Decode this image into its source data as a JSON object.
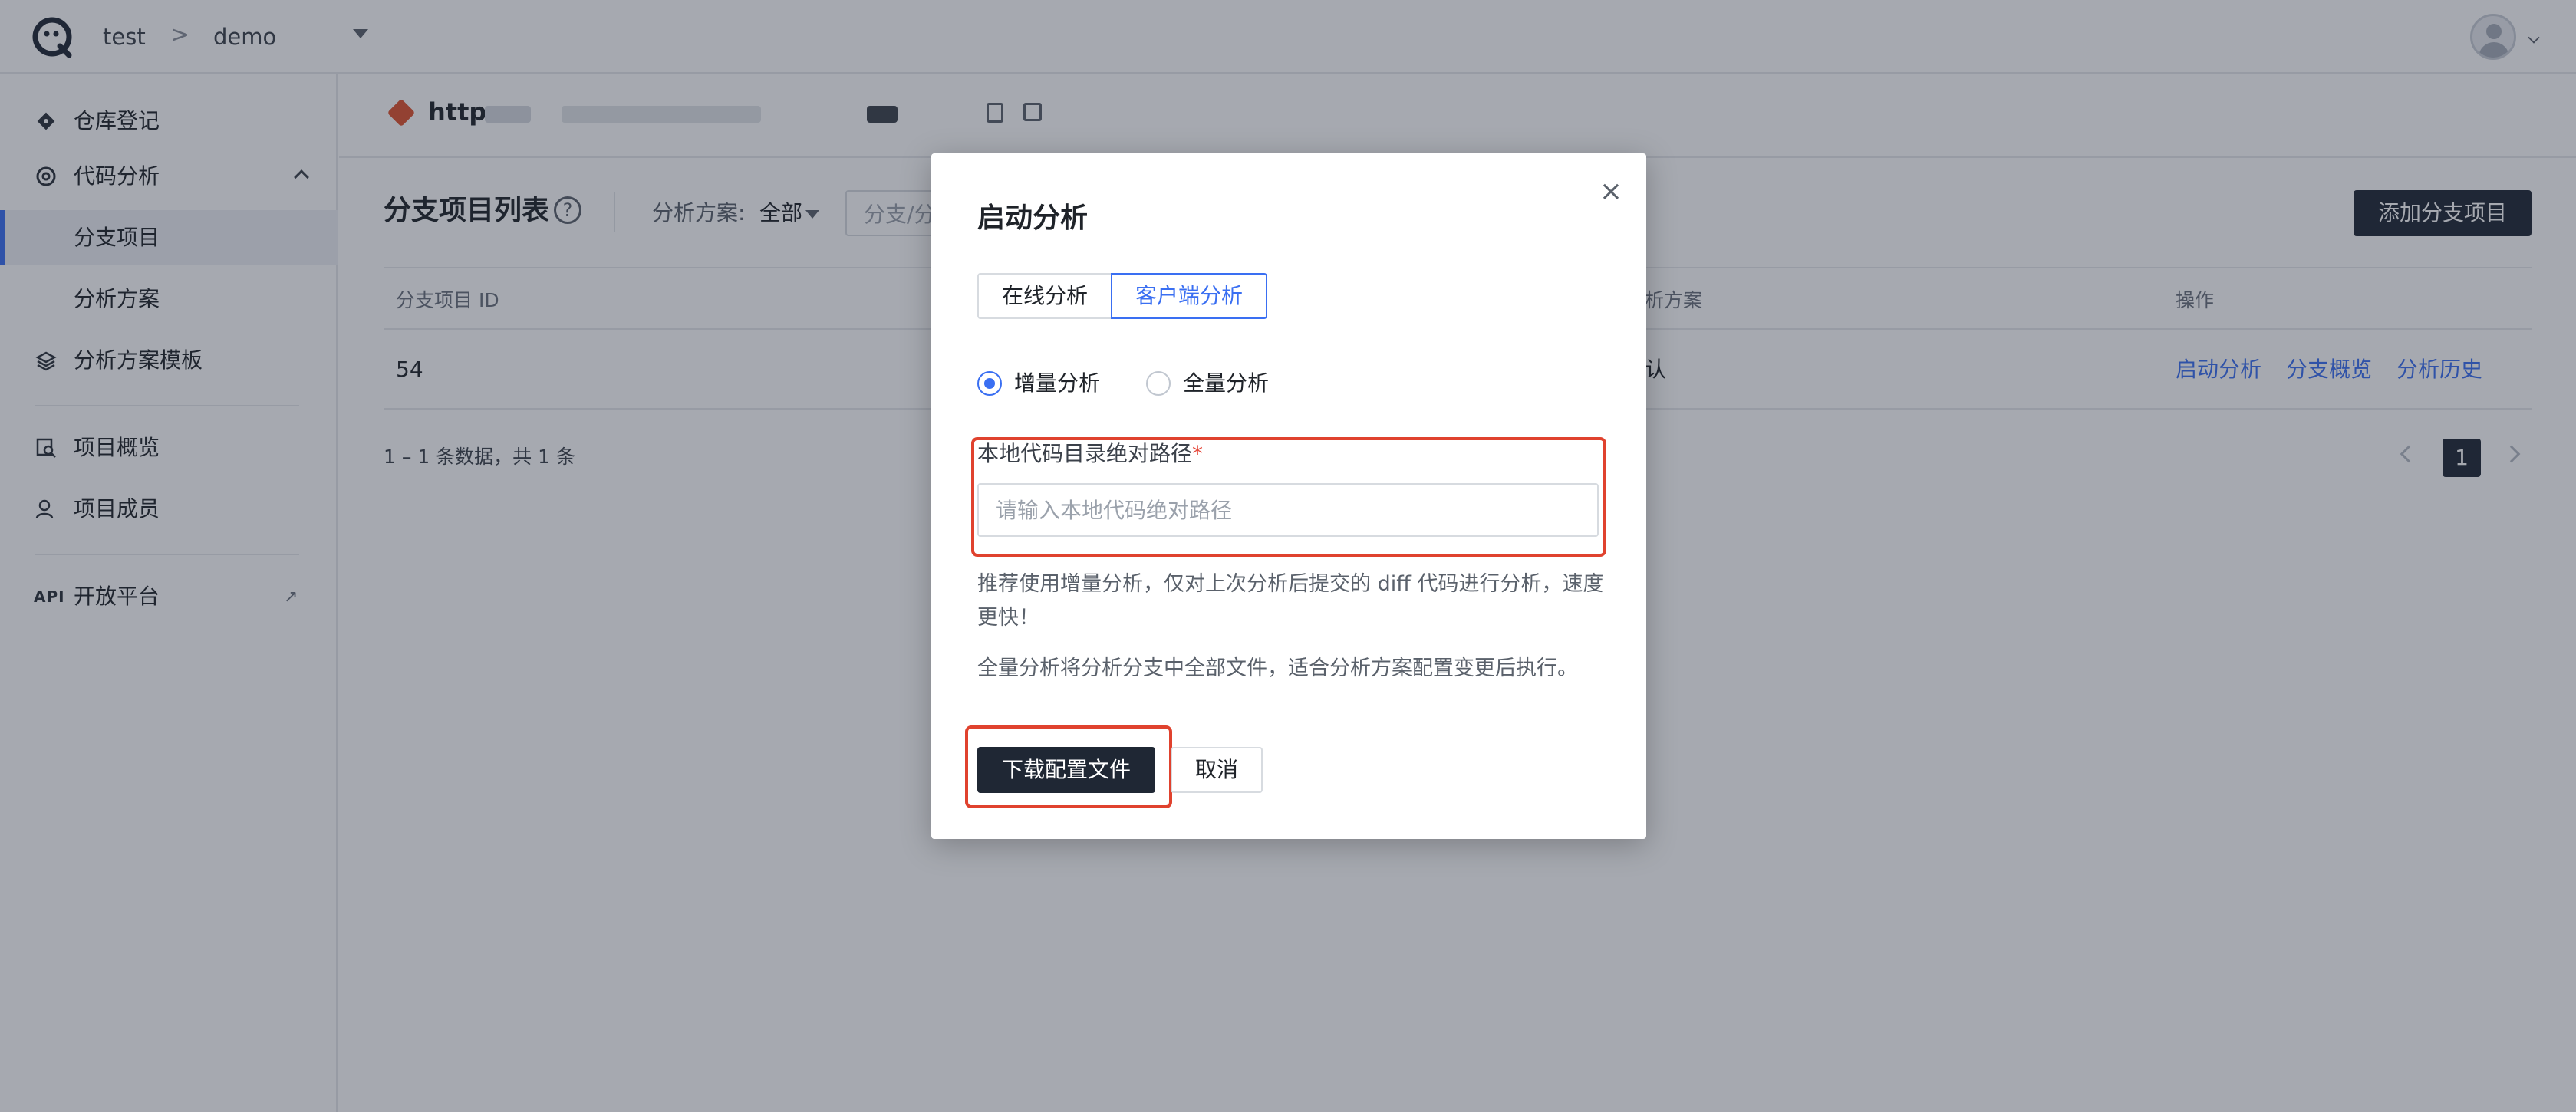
{
  "header": {
    "team": "test",
    "project": "demo",
    "separator": ">"
  },
  "sidebar": {
    "items": [
      {
        "label": "仓库登记",
        "icon": "diamond-icon"
      },
      {
        "label": "代码分析",
        "icon": "radar-icon"
      },
      {
        "label": "分支项目",
        "active": true
      },
      {
        "label": "分析方案"
      },
      {
        "label": "分析方案模板",
        "icon": "layers-icon"
      },
      {
        "label": "项目概览",
        "icon": "chart-search-icon"
      },
      {
        "label": "项目成员",
        "icon": "user-icon"
      },
      {
        "label": "开放平台",
        "icon": "api-icon",
        "icon_text": "API"
      }
    ]
  },
  "repo": {
    "url_prefix": "http"
  },
  "main": {
    "title": "分支项目列表",
    "filter_label": "分析方案:",
    "filter_value": "全部",
    "search_placeholder": "分支/分",
    "add_button": "添加分支项目",
    "table": {
      "headers": [
        "分支项目 ID",
        "析方案",
        "操作"
      ],
      "rows": [
        {
          "id": "54",
          "scheme": "认",
          "actions": [
            "启动分析",
            "分支概览",
            "分析历史"
          ]
        }
      ]
    },
    "footer": "1 – 1 条数据，共 1 条",
    "pagination": {
      "current": "1"
    }
  },
  "modal": {
    "title": "启动分析",
    "close": "×",
    "tabs": [
      "在线分析",
      "客户端分析"
    ],
    "active_tab": 1,
    "radios": [
      {
        "label": "增量分析",
        "checked": true
      },
      {
        "label": "全量分析",
        "checked": false
      }
    ],
    "field_label": "本地代码目录绝对路径",
    "required_mark": "*",
    "field_placeholder": "请输入本地代码绝对路径",
    "hint1": "推荐使用增量分析，仅对上次分析后提交的 diff 代码进行分析，速度更快！",
    "hint2": "全量分析将分析分支中全部文件，适合分析方案配置变更后执行。",
    "primary_button": "下载配置文件",
    "cancel_button": "取消"
  },
  "colors": {
    "accent": "#3a6ff2",
    "primary_dark": "#1f2734",
    "highlight": "#e0422e",
    "danger": "#e5483a"
  }
}
